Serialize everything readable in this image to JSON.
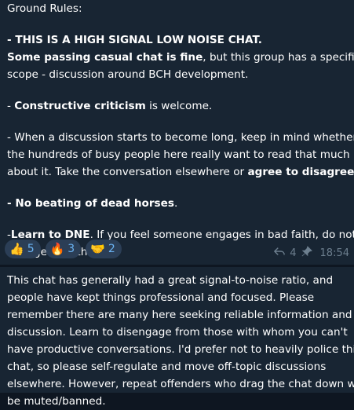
{
  "message1": {
    "lines": [
      [
        {
          "t": "Ground Rules:",
          "b": false
        }
      ],
      [],
      [
        {
          "t": "- THIS IS A HIGH SIGNAL LOW NOISE CHAT.",
          "b": true
        }
      ],
      [
        {
          "t": "Some passing casual chat is fine",
          "b": true
        },
        {
          "t": ", but this group has a specific",
          "b": false
        }
      ],
      [
        {
          "t": "scope - discussion around BCH development.",
          "b": false
        }
      ],
      [],
      [
        {
          "t": "- ",
          "b": false
        },
        {
          "t": "Constructive criticism",
          "b": true
        },
        {
          "t": " is welcome.",
          "b": false
        }
      ],
      [],
      [
        {
          "t": "- When a discussion starts to become long, keep in mind whether",
          "b": false
        }
      ],
      [
        {
          "t": "the hundreds of busy people here really want to read that much",
          "b": false
        }
      ],
      [
        {
          "t": "about it. Take the conversation elsewhere or ",
          "b": false
        },
        {
          "t": "agree to disagree",
          "b": true
        },
        {
          "t": ".",
          "b": false
        }
      ],
      [],
      [
        {
          "t": "- No beating of dead horses",
          "b": true
        },
        {
          "t": ".",
          "b": false
        }
      ],
      [],
      [
        {
          "t": "-",
          "b": false
        },
        {
          "t": "Learn to DNE",
          "b": true
        },
        {
          "t": ". If you feel someone engages in bad faith, do not",
          "b": false
        }
      ],
      [
        {
          "t": "engage with them.",
          "b": false
        }
      ]
    ],
    "reactions": [
      {
        "emoji": "👍",
        "icon": "thumbs-up-icon",
        "count": "5"
      },
      {
        "emoji": "🔥",
        "icon": "fire-icon",
        "count": "3"
      },
      {
        "emoji": "🤝",
        "icon": "handshake-icon",
        "count": "2"
      }
    ],
    "replies": "4",
    "time": "18:54"
  },
  "message2": {
    "lines": [
      "This chat has generally had a great signal-to-noise ratio, and",
      "people have kept things professional and focused.  Please",
      "remember there are many here seeking reliable information and",
      "discussion. Learn to disengage from those with whom you can't",
      "have productive conversations. I'd prefer not to heavily police this",
      "chat, so please self-regulate and move off-topic discussions",
      "elsewhere. However, repeat offenders who drag the chat down will",
      "be muted/banned."
    ]
  },
  "colors": {
    "background": "#0e1621",
    "bubble": "#182533",
    "reaction_bg": "#2b3e56",
    "reaction_text": "#6ab3f3",
    "meta_text": "#6d7f8f"
  }
}
